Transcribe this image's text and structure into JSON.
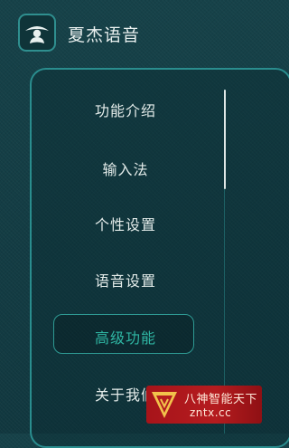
{
  "header": {
    "logo_icon": "face-logo-icon",
    "title": "夏杰语音"
  },
  "menu": {
    "items": [
      {
        "label": "功能介绍",
        "active": false
      },
      {
        "label": "输入法",
        "active": false
      },
      {
        "label": "个性设置",
        "active": false
      },
      {
        "label": "语音设置",
        "active": false
      },
      {
        "label": "高级功能",
        "active": true
      },
      {
        "label": "关于我们",
        "active": false
      }
    ]
  },
  "watermark": {
    "title": "八神智能天下",
    "url": "zntx.cc"
  },
  "colors": {
    "background": "#123a41",
    "accent": "#2a8d8e",
    "active_text": "#2fb6a3",
    "text": "#e4ecea",
    "watermark_bg": "#a7141a"
  }
}
